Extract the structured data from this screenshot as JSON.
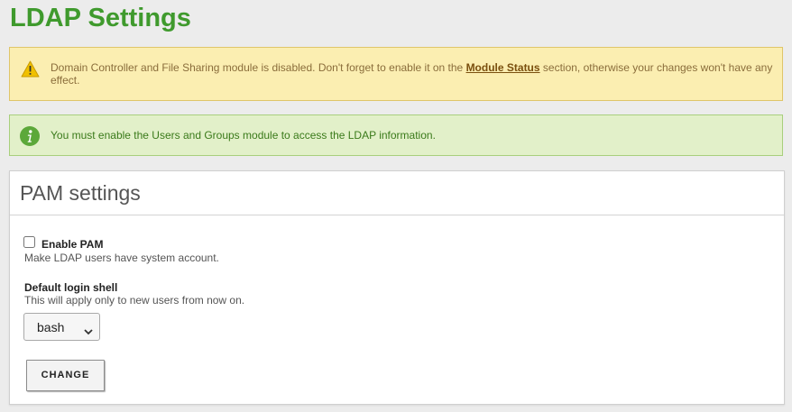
{
  "page": {
    "title": "LDAP Settings"
  },
  "alerts": {
    "warning": {
      "icon": "warning-icon",
      "text_before": "Domain Controller and File Sharing module is disabled. Don't forget to enable it on the ",
      "link": "Module Status",
      "text_after": " section, otherwise your changes won't have any effect.",
      "color": "#fbeeb1"
    },
    "info": {
      "icon": "info-icon",
      "text": "You must enable the Users and Groups module to access the LDAP information.",
      "color": "#e2f0c9"
    }
  },
  "panel": {
    "title": "PAM settings",
    "enable_pam": {
      "label": "Enable PAM",
      "help": "Make LDAP users have system account.",
      "checked": false
    },
    "login_shell": {
      "label": "Default login shell",
      "help": "This will apply only to new users from now on.",
      "value": "bash"
    },
    "change_button": "CHANGE"
  },
  "colors": {
    "title": "#3f9a2d",
    "background": "#ececec"
  }
}
